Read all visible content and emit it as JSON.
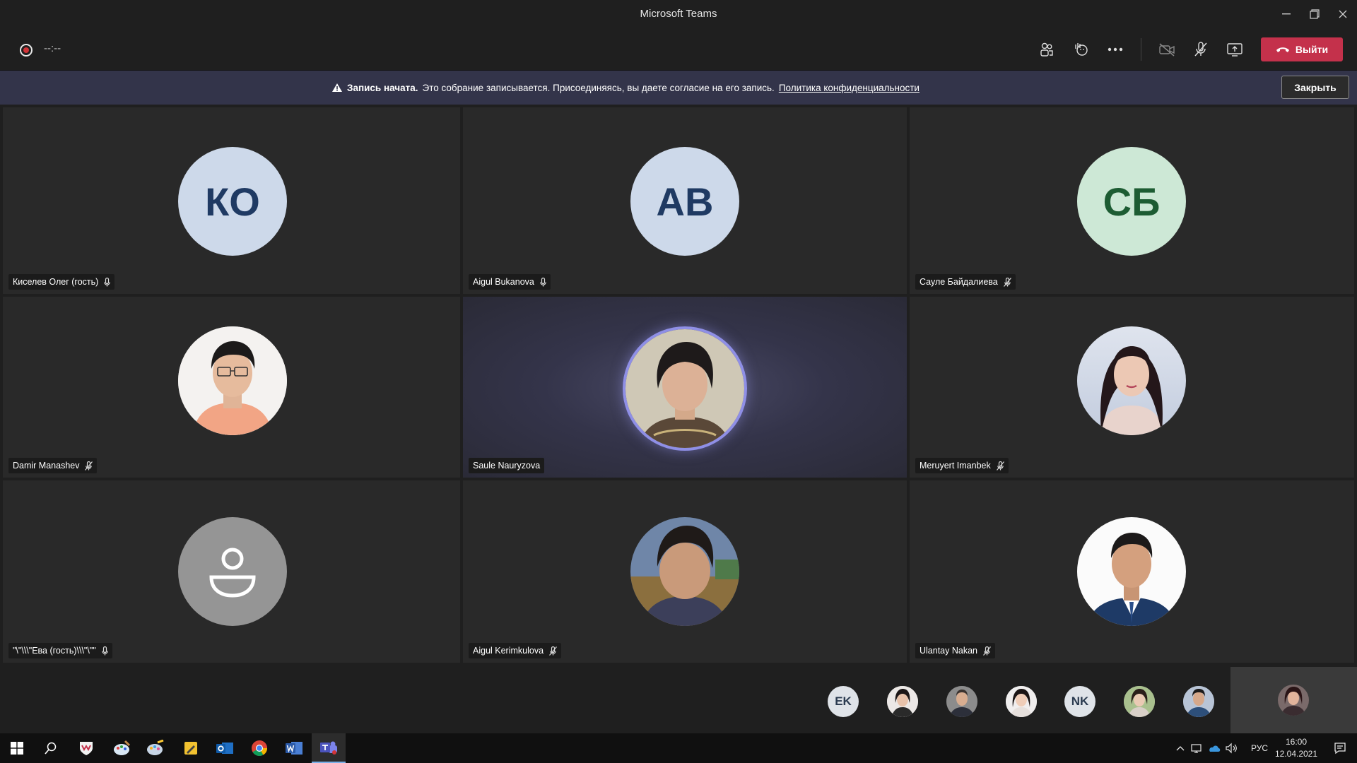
{
  "window": {
    "title": "Microsoft Teams"
  },
  "callbar": {
    "timer": "--:--",
    "leave_label": "Выйти"
  },
  "banner": {
    "bold": "Запись начата.",
    "text": "Это собрание записывается. Присоединяясь, вы даете согласие на его запись.",
    "link": "Политика конфиденциальности",
    "close_label": "Закрыть"
  },
  "participants": [
    {
      "name": "Киселев Олег (гость)",
      "initials": "КО",
      "mic": "on",
      "avatar_bg": "#cdd9ea",
      "avatar_fg": "#1f3a63"
    },
    {
      "name": "Aigul Bukanova",
      "initials": "AB",
      "mic": "on",
      "avatar_bg": "#cdd9ea",
      "avatar_fg": "#1f3a63"
    },
    {
      "name": "Сауле Байдалиева",
      "initials": "СБ",
      "mic": "off",
      "avatar_bg": "#cde8d6",
      "avatar_fg": "#1d5c33"
    },
    {
      "name": "Damir Manashev",
      "mic": "off"
    },
    {
      "name": "Saule Nauryzova",
      "mic": "none"
    },
    {
      "name": "Meruyert Imanbek",
      "mic": "off"
    },
    {
      "name": "\"\\\"\\\\\\\"Ева (гость)\\\\\\\"\\\"\"",
      "mic": "on"
    },
    {
      "name": "Aigul Kerimkulova",
      "mic": "off"
    },
    {
      "name": "Ulantay Nakan",
      "mic": "off"
    }
  ],
  "overflow": [
    {
      "initials": "EK",
      "bg": "#dfe3e8",
      "fg": "#2a3a4f"
    },
    {
      "initials": "",
      "photo": "woman"
    },
    {
      "initials": "",
      "photo": "man"
    },
    {
      "initials": "",
      "photo": "woman"
    },
    {
      "initials": "NK",
      "bg": "#dfe3e8",
      "fg": "#2a3a4f"
    },
    {
      "initials": "",
      "photo": "woman"
    },
    {
      "initials": "",
      "photo": "man"
    }
  ],
  "taskbar": {
    "language": "РУС",
    "time": "16:00",
    "date": "12.04.2021"
  },
  "colors": {
    "leave": "#c4314b",
    "banner": "#33344a",
    "tile": "#292929",
    "speaker_ring": "#8f8fe6",
    "record": "#d13438"
  }
}
